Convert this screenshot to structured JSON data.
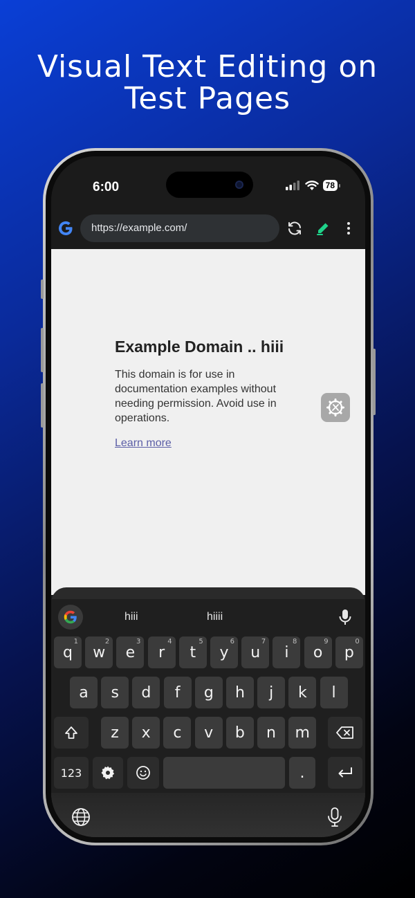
{
  "headline": {
    "line1": "Visual Text Editing on",
    "line2": "Test Pages"
  },
  "status_bar": {
    "time": "6:00",
    "battery": "78"
  },
  "browser": {
    "url": "https://example.com/"
  },
  "web_page": {
    "heading": "Example Domain .. hiii",
    "paragraph": "This domain is for use in documentation examples without needing permission. Avoid use in operations.",
    "link": "Learn more"
  },
  "keyboard": {
    "suggestions": [
      "hiii",
      "hiiii"
    ],
    "row1": [
      {
        "key": "q",
        "hint": "1"
      },
      {
        "key": "w",
        "hint": "2"
      },
      {
        "key": "e",
        "hint": "3"
      },
      {
        "key": "r",
        "hint": "4"
      },
      {
        "key": "t",
        "hint": "5"
      },
      {
        "key": "y",
        "hint": "6"
      },
      {
        "key": "u",
        "hint": "7"
      },
      {
        "key": "i",
        "hint": "8"
      },
      {
        "key": "o",
        "hint": "9"
      },
      {
        "key": "p",
        "hint": "0"
      }
    ],
    "row2": [
      "a",
      "s",
      "d",
      "f",
      "g",
      "h",
      "j",
      "k",
      "l"
    ],
    "row3": [
      "z",
      "x",
      "c",
      "v",
      "b",
      "n",
      "m"
    ],
    "numbers_label": "123",
    "period_label": "."
  },
  "colors": {
    "accent_pen": "#1fd38a",
    "google_blue": "#4285f4",
    "link": "#5b5ea6"
  }
}
